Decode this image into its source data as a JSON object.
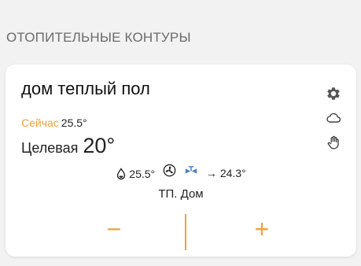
{
  "section": {
    "title": "ОТОПИТЕЛЬНЫЕ КОНТУРЫ"
  },
  "card": {
    "title": "дом теплый пол",
    "now_label": "Сейчас",
    "now_value": "25.5°",
    "target_label": "Целевая",
    "target_value": "20°",
    "sensor_value": "25.5°",
    "arrow": "→",
    "return_value": "24.3°",
    "mode": "ТП. Дом",
    "minus_label": "−",
    "plus_label": "+"
  },
  "icons": {
    "settings": "gear-icon",
    "weather": "cloud-icon",
    "hand": "hand-icon",
    "sensor": "drop-icon",
    "pump": "fan-icon",
    "valve": "valve-icon"
  },
  "colors": {
    "accent": "#f0a13c",
    "background": "#f2f2f2",
    "card": "#ffffff"
  }
}
